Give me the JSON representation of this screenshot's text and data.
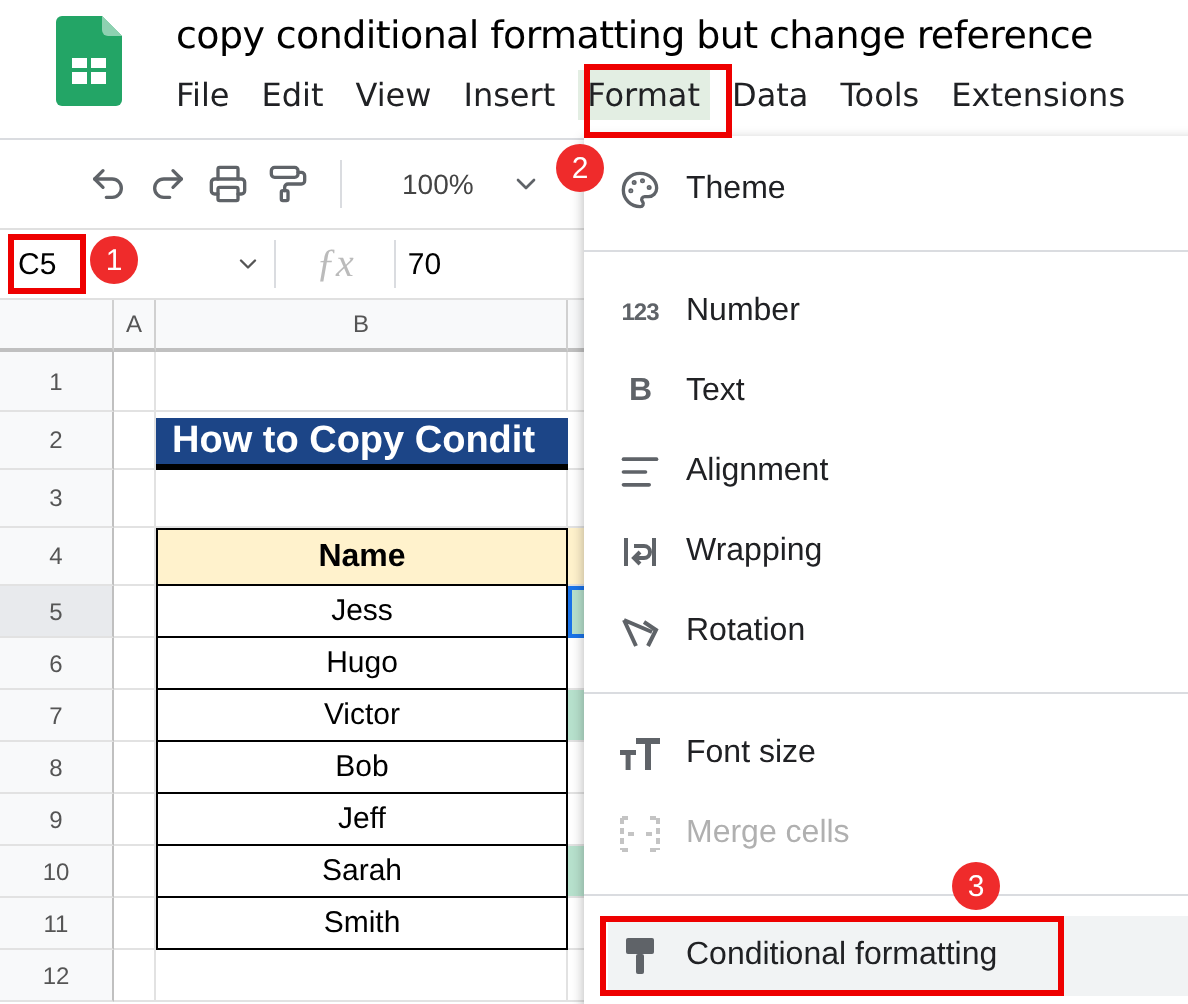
{
  "app": {
    "title": "copy conditional formatting but change reference",
    "menus": [
      {
        "label": "File",
        "selected": false
      },
      {
        "label": "Edit",
        "selected": false
      },
      {
        "label": "View",
        "selected": false
      },
      {
        "label": "Insert",
        "selected": false
      },
      {
        "label": "Format",
        "selected": true
      },
      {
        "label": "Data",
        "selected": false
      },
      {
        "label": "Tools",
        "selected": false
      },
      {
        "label": "Extensions",
        "selected": false
      }
    ]
  },
  "toolbar": {
    "zoom": "100%"
  },
  "formula_bar": {
    "cell_ref": "C5",
    "function_label": "ƒx",
    "value": "70"
  },
  "sheet": {
    "columns": [
      "A",
      "B"
    ],
    "rows": [
      {
        "number": "1",
        "kind": "empty",
        "selected": false
      },
      {
        "number": "2",
        "kind": "banner",
        "text": "How to Copy Condit",
        "selected": false
      },
      {
        "number": "3",
        "kind": "empty",
        "selected": false
      },
      {
        "number": "4",
        "kind": "header",
        "text": "Name",
        "selected": false
      },
      {
        "number": "5",
        "kind": "data",
        "text": "Jess",
        "highlighted": true,
        "selected": true
      },
      {
        "number": "6",
        "kind": "data",
        "text": "Hugo",
        "highlighted": false,
        "selected": false
      },
      {
        "number": "7",
        "kind": "data",
        "text": "Victor",
        "highlighted": true,
        "selected": false
      },
      {
        "number": "8",
        "kind": "data",
        "text": "Bob",
        "highlighted": false,
        "selected": false
      },
      {
        "number": "9",
        "kind": "data",
        "text": "Jeff",
        "highlighted": false,
        "selected": false
      },
      {
        "number": "10",
        "kind": "data",
        "text": "Sarah",
        "highlighted": true,
        "selected": false
      },
      {
        "number": "11",
        "kind": "data",
        "text": "Smith",
        "highlighted": false,
        "selected": false
      },
      {
        "number": "12",
        "kind": "empty",
        "selected": false
      }
    ]
  },
  "format_menu": {
    "items": [
      {
        "kind": "item",
        "label": "Theme",
        "disabled": false,
        "selected": false
      },
      {
        "kind": "divider"
      },
      {
        "kind": "item",
        "label": "Number",
        "icon_text": "123",
        "disabled": false,
        "selected": false
      },
      {
        "kind": "item",
        "label": "Text",
        "icon_text": "B",
        "disabled": false,
        "selected": false
      },
      {
        "kind": "item",
        "label": "Alignment",
        "disabled": false,
        "selected": false
      },
      {
        "kind": "item",
        "label": "Wrapping",
        "disabled": false,
        "selected": false
      },
      {
        "kind": "item",
        "label": "Rotation",
        "disabled": false,
        "selected": false
      },
      {
        "kind": "divider"
      },
      {
        "kind": "item",
        "label": "Font size",
        "disabled": false,
        "selected": false
      },
      {
        "kind": "item",
        "label": "Merge cells",
        "disabled": true,
        "selected": false
      },
      {
        "kind": "divider"
      },
      {
        "kind": "item",
        "label": "Conditional formatting",
        "disabled": false,
        "selected": true
      }
    ]
  },
  "callouts": [
    {
      "number": "1"
    },
    {
      "number": "2"
    },
    {
      "number": "3"
    }
  ]
}
